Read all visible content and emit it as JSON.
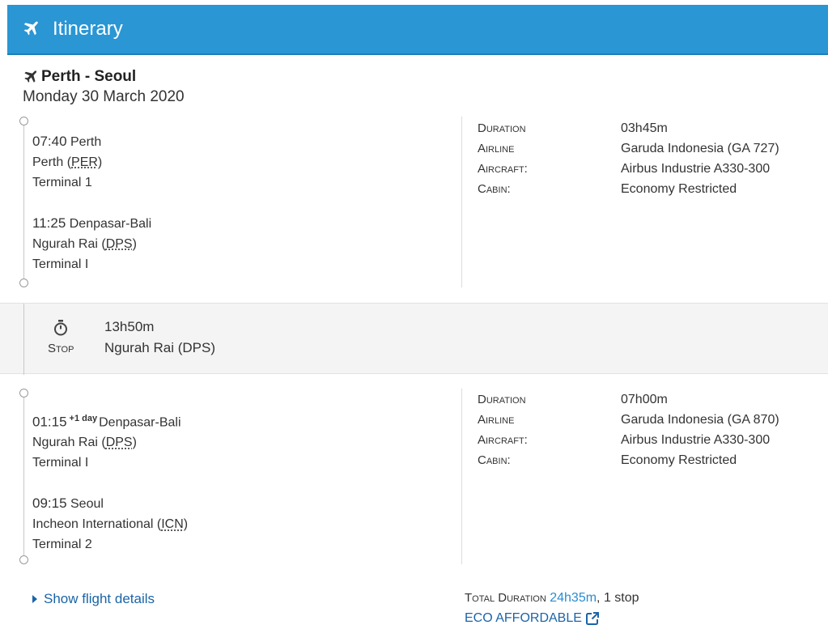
{
  "header": {
    "title": "Itinerary",
    "icon": "plane-icon",
    "color": "#2a96d4"
  },
  "route": {
    "name": "Perth - Seoul",
    "date": "Monday 30 March 2020"
  },
  "segments": [
    {
      "departure": {
        "time": "07:40",
        "city": "Perth",
        "airport_name": "Perth (",
        "airport_code": "PER",
        "airport_close": ")",
        "terminal": "Terminal 1"
      },
      "arrival": {
        "time": "11:25",
        "city": "Denpasar-Bali",
        "airport_name": "Ngurah Rai (",
        "airport_code": "DPS",
        "airport_close": ")",
        "terminal": "Terminal I"
      },
      "details": [
        {
          "label": "Duration",
          "value": "03h45m"
        },
        {
          "label": "Airline",
          "value": "Garuda Indonesia (GA 727)"
        },
        {
          "label": "Aircraft:",
          "value": "Airbus Industrie A330-300"
        },
        {
          "label": "Cabin:",
          "value": "Economy Restricted"
        }
      ]
    },
    {
      "departure": {
        "time": "01:15",
        "day_offset": "+1 day",
        "city": "Denpasar-Bali",
        "airport_name": "Ngurah Rai (",
        "airport_code": "DPS",
        "airport_close": ")",
        "terminal": "Terminal I"
      },
      "arrival": {
        "time": "09:15",
        "city": "Seoul",
        "airport_name": "Incheon International (",
        "airport_code": "ICN",
        "airport_close": ")",
        "terminal": "Terminal 2"
      },
      "details": [
        {
          "label": "Duration",
          "value": "07h00m"
        },
        {
          "label": "Airline",
          "value": "Garuda Indonesia (GA 870)"
        },
        {
          "label": "Aircraft:",
          "value": "Airbus Industrie A330-300"
        },
        {
          "label": "Cabin:",
          "value": "Economy Restricted"
        }
      ]
    }
  ],
  "stop": {
    "label": "Stop",
    "duration": "13h50m",
    "place": "Ngurah Rai (DPS)",
    "icon": "stopwatch-icon"
  },
  "footer": {
    "show_details": "Show flight details",
    "total_label": "Total Duration",
    "total_value": "24h35m",
    "stops": ", 1 stop",
    "fare_label": "ECO AFFORDABLE",
    "link_color": "#1a64a8"
  }
}
